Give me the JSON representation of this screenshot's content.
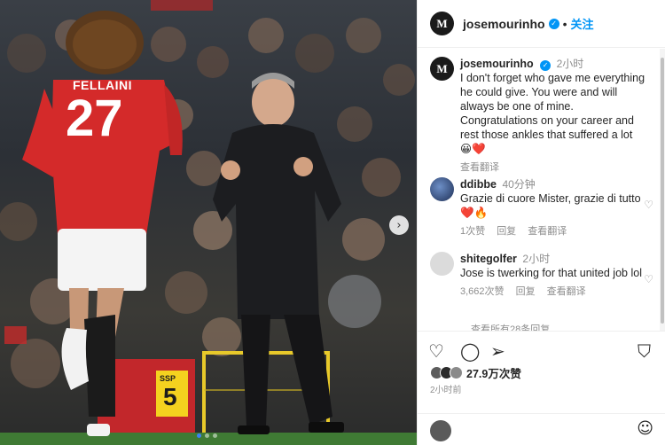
{
  "photo": {
    "jersey_name": "FELLAINI",
    "jersey_number": "27",
    "sign_text": "SSP",
    "sign_number": "5",
    "next_icon": "chevron-right-icon",
    "carousel_dots": 3,
    "active_dot": 1
  },
  "header": {
    "avatar_letter": "M",
    "username": "josemourinho",
    "verified_icon": "verified-badge-icon",
    "separator": "•",
    "follow_label": "关注"
  },
  "caption": {
    "username": "josemourinho",
    "time": "2小时",
    "text": "I don't forget who gave me everything he could give. You were and will always be one of mine. Congratulations on your career and rest those ankles that suffered a lot",
    "emojis": "😀❤️",
    "translate_label": "查看翻译"
  },
  "comments": [
    {
      "username": "ddibbe",
      "time": "40分钟",
      "text": "Grazie di cuore Mister, grazie di tutto❤️🔥",
      "likes": "1次赞",
      "reply_label": "回复",
      "translate_label": "查看翻译"
    },
    {
      "username": "shitegolfer",
      "time": "2小时",
      "text": "Jose is twerking for that united job lol",
      "likes": "3,662次赞",
      "reply_label": "回复",
      "translate_label": "查看翻译"
    }
  ],
  "more_replies": "查看所有28条回复",
  "actions": {
    "like_icon": "heart-outline-icon",
    "comment_icon": "comment-icon",
    "share_icon": "send-icon",
    "save_icon": "bookmark-icon"
  },
  "likes_count": "27.9万次赞",
  "post_time": "2小时前",
  "emoji_button_icon": "smile-icon",
  "colors": {
    "accent": "#0095f6",
    "united_red": "#d42a2a",
    "text": "#262626",
    "muted": "#8e8e8e"
  }
}
